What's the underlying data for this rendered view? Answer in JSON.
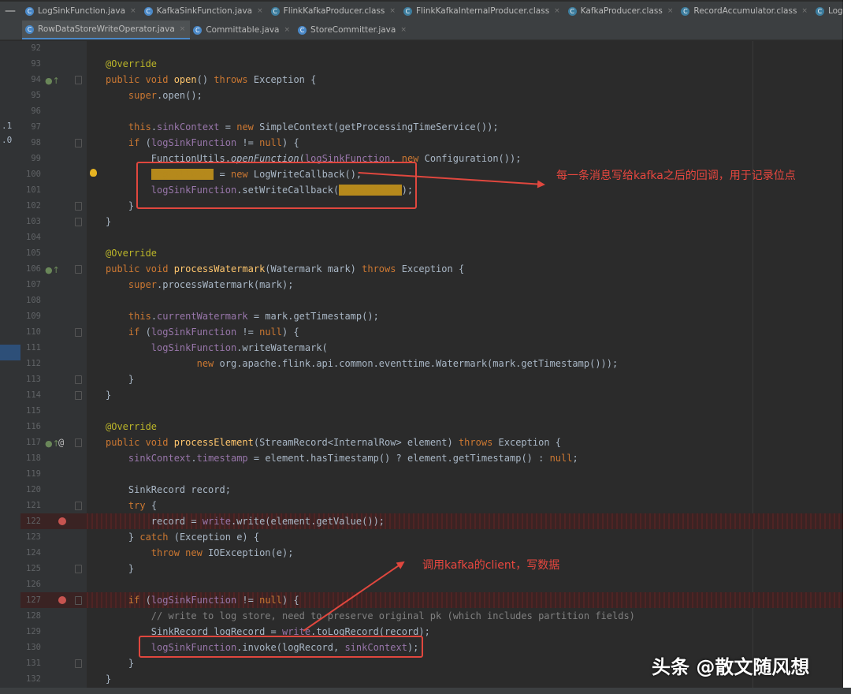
{
  "tabs_row1": [
    {
      "icon": "java",
      "label": "LogSinkFunction.java",
      "close": "×"
    },
    {
      "icon": "java",
      "label": "KafkaSinkFunction.java",
      "close": "×"
    },
    {
      "icon": "class",
      "label": "FlinkKafkaProducer.class",
      "close": "×"
    },
    {
      "icon": "class",
      "label": "FlinkKafkaInternalProducer.class",
      "close": "×"
    },
    {
      "icon": "class",
      "label": "KafkaProducer.class",
      "close": "×"
    },
    {
      "icon": "class",
      "label": "RecordAccumulator.class",
      "close": "×"
    },
    {
      "icon": "class",
      "label": "LogWriteCallba",
      "close": ""
    }
  ],
  "tabs_row2": [
    {
      "icon": "java",
      "label": "RowDataStoreWriteOperator.java",
      "close": "×",
      "active": true
    },
    {
      "icon": "java",
      "label": "Committable.java",
      "close": "×"
    },
    {
      "icon": "java",
      "label": "StoreCommitter.java",
      "close": "×"
    }
  ],
  "minimize_glyph": "—",
  "left_strip": {
    "n1": ".1",
    "n2": ".0"
  },
  "lines": [
    {
      "n": "92",
      "html": ""
    },
    {
      "n": "93",
      "html": "<span class=\"an\">@Override</span>"
    },
    {
      "n": "94",
      "html": "<span class=\"kw\">public void </span><span class=\"fn\">open</span>() <span class=\"kw\">throws </span>Exception {",
      "ovr": true
    },
    {
      "n": "95",
      "html": "    <span class=\"kw\">super</span>.open();"
    },
    {
      "n": "96",
      "html": ""
    },
    {
      "n": "97",
      "html": "    <span class=\"kw\">this</span>.<span class=\"fld\">sinkContext</span> = <span class=\"kw\">new </span>SimpleContext(getProcessingTimeService());"
    },
    {
      "n": "98",
      "html": "    <span class=\"kw\">if </span>(<span class=\"fld\">logSinkFunction</span> != <span class=\"kw\">null</span>) {"
    },
    {
      "n": "99",
      "html": "        FunctionUtils.<i>openFunction</i>(<span class=\"fld\">logSinkFunction</span>, <span class=\"kw\">new </span>Configuration());"
    },
    {
      "n": "100",
      "html": "        <span class=\"hl\">logCallback</span> = <span class=\"kw\">new </span>LogWriteCallback();",
      "bulb": true
    },
    {
      "n": "101",
      "html": "        <span class=\"fld\">logSinkFunction</span>.setWriteCallback(<span class=\"hl\">logCallback</span>);"
    },
    {
      "n": "102",
      "html": "    }"
    },
    {
      "n": "103",
      "html": "}"
    },
    {
      "n": "104",
      "html": ""
    },
    {
      "n": "105",
      "html": "<span class=\"an\">@Override</span>"
    },
    {
      "n": "106",
      "html": "<span class=\"kw\">public void </span><span class=\"fn\">processWatermark</span>(Watermark mark) <span class=\"kw\">throws </span>Exception {",
      "ovr": true
    },
    {
      "n": "107",
      "html": "    <span class=\"kw\">super</span>.processWatermark(mark);"
    },
    {
      "n": "108",
      "html": ""
    },
    {
      "n": "109",
      "html": "    <span class=\"kw\">this</span>.<span class=\"fld\">currentWatermark</span> = mark.getTimestamp();"
    },
    {
      "n": "110",
      "html": "    <span class=\"kw\">if </span>(<span class=\"fld\">logSinkFunction</span> != <span class=\"kw\">null</span>) {"
    },
    {
      "n": "111",
      "html": "        <span class=\"fld\">logSinkFunction</span>.writeWatermark("
    },
    {
      "n": "112",
      "html": "                <span class=\"kw\">new </span>org.apache.flink.api.common.eventtime.Watermark(mark.getTimestamp()));"
    },
    {
      "n": "113",
      "html": "    }"
    },
    {
      "n": "114",
      "html": "}"
    },
    {
      "n": "115",
      "html": ""
    },
    {
      "n": "116",
      "html": "<span class=\"an\">@Override</span>"
    },
    {
      "n": "117",
      "html": "<span class=\"kw\">public void </span><span class=\"fn\">processElement</span>(StreamRecord&lt;InternalRow&gt; element) <span class=\"kw\">throws </span>Exception {",
      "ovr": true,
      "at": true
    },
    {
      "n": "118",
      "html": "    <span class=\"fld\">sinkContext</span>.<span class=\"fld\">timestamp</span> = element.hasTimestamp() ? element.getTimestamp() : <span class=\"kw\">null</span>;"
    },
    {
      "n": "119",
      "html": ""
    },
    {
      "n": "120",
      "html": "    SinkRecord record;"
    },
    {
      "n": "121",
      "html": "    <span class=\"kw\">try </span>{"
    },
    {
      "n": "122",
      "html": "        record = <span class=\"fld\">write</span>.write(element.getValue());",
      "bp": true
    },
    {
      "n": "123",
      "html": "    } <span class=\"kw\">catch </span>(Exception e) {"
    },
    {
      "n": "124",
      "html": "        <span class=\"kw\">throw new </span>IOException(e);"
    },
    {
      "n": "125",
      "html": "    }"
    },
    {
      "n": "126",
      "html": ""
    },
    {
      "n": "127",
      "html": "    <span class=\"kw\">if </span>(<span class=\"fld\">logSinkFunction</span> != <span class=\"kw\">null</span>) {",
      "bp": true
    },
    {
      "n": "128",
      "html": "        <span class=\"cm\">// write to log store, need to preserve original pk (which includes partition fields)</span>"
    },
    {
      "n": "129",
      "html": "        SinkRecord logRecord = <span class=\"fld\">write</span>.toLogRecord(record);"
    },
    {
      "n": "130",
      "html": "        <span class=\"fld\">logSinkFunction</span>.invoke(logRecord, <span class=\"fld\">sinkContext</span>);"
    },
    {
      "n": "131",
      "html": "    }"
    },
    {
      "n": "132",
      "html": "}"
    }
  ],
  "annotations": {
    "a1": "每一条消息写给kafka之后的回调，用于记录位点",
    "a2": "调用kafka的client，写数据"
  },
  "watermark": "头条 @散文随风想",
  "colors": {
    "annotation": "#e8473f",
    "editor_bg": "#2b2b2b",
    "gutter_bg": "#313335",
    "keyword": "#cc7832"
  }
}
